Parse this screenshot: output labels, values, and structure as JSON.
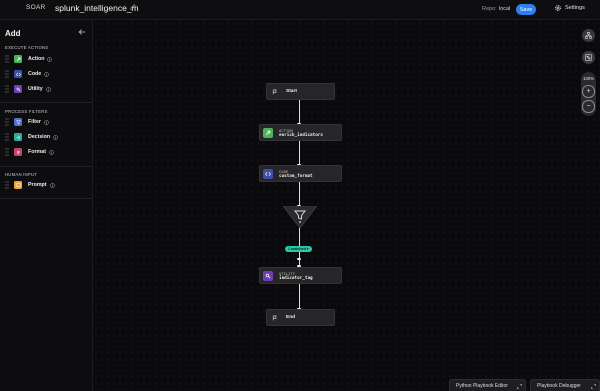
{
  "header": {
    "brand": "SOAR",
    "playbook_name": "splunk_intelligence_m",
    "repo_label": "Repo:",
    "repo_value": "local",
    "save_label": "Save",
    "settings_label": "Settings"
  },
  "sidebar": {
    "title": "Add",
    "sections": [
      {
        "heading": "EXECUTE ACTIONS",
        "items": [
          {
            "label": "Action",
            "color": "#4bb35a",
            "icon": "action-icon"
          },
          {
            "label": "Code",
            "color": "#3d4fa8",
            "icon": "code-icon"
          },
          {
            "label": "Utility",
            "color": "#6f3fb5",
            "icon": "utility-icon"
          }
        ]
      },
      {
        "heading": "PROCESS FILTERS",
        "items": [
          {
            "label": "Filter",
            "color": "#4c6fd1",
            "icon": "filter-icon"
          },
          {
            "label": "Decision",
            "color": "#36a89a",
            "icon": "decision-icon"
          },
          {
            "label": "Format",
            "color": "#c0476a",
            "icon": "format-icon"
          }
        ]
      },
      {
        "heading": "HUMAN INPUT",
        "items": [
          {
            "label": "Prompt",
            "color": "#e8a73a",
            "icon": "prompt-icon"
          }
        ]
      }
    ]
  },
  "canvas": {
    "nodes": [
      {
        "id": "start",
        "label": "Start"
      },
      {
        "id": "action",
        "type_label": "ACTION",
        "name": "enrich_indicators",
        "color": "#4bb35a"
      },
      {
        "id": "code",
        "type_label": "CODE",
        "name": "custom_format",
        "color": "#3d4fa8"
      },
      {
        "id": "filter",
        "color": "#4c6fd1"
      },
      {
        "id": "utility",
        "type_label": "UTILITY",
        "name": "indicator_tag",
        "color": "#6f3fb5"
      },
      {
        "id": "end",
        "label": "End"
      }
    ],
    "filter_badge": "1 matched ▾"
  },
  "toolbar": {
    "zoom_level": "100%"
  },
  "bottom_tabs": [
    "Python Playbook Editor",
    "Playbook Debugger"
  ],
  "colors": {
    "accent": "#2f7ef0",
    "badge": "#2ec7a5"
  }
}
